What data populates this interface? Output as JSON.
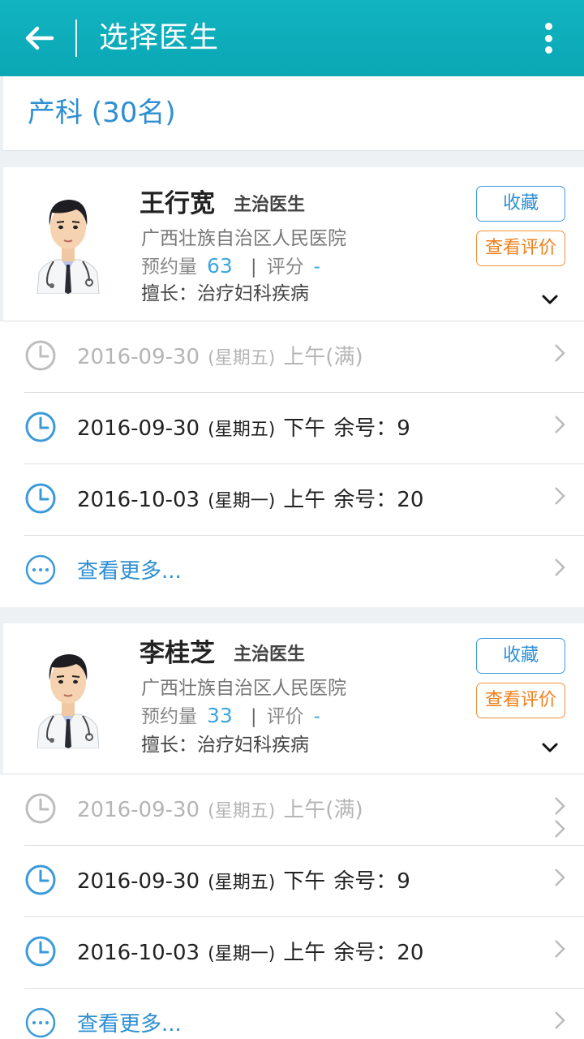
{
  "header": {
    "title": "选择医生"
  },
  "department": {
    "title": "产科  (30名)"
  },
  "doctors": [
    {
      "name": "王行宽",
      "title": "主治医生",
      "hospital": "广西壮族自治区人民医院",
      "stats_label": "预约量",
      "stats_value": "63",
      "rating_label": "评分",
      "rating_value": "-",
      "skill": "擅长：治疗妇科疾病",
      "favorite_label": "收藏",
      "review_label": "查看评价",
      "slots": [
        {
          "date": "2016-09-30",
          "weekday": "(星期五)",
          "period": "上午",
          "status": "(满)",
          "disabled": true
        },
        {
          "date": "2016-09-30",
          "weekday": "(星期五)",
          "period": "下午",
          "status": "余号：9",
          "disabled": false
        },
        {
          "date": "2016-10-03",
          "weekday": "(星期一)",
          "period": "上午",
          "status": "余号：20",
          "disabled": false
        }
      ],
      "more_label": "查看更多..."
    },
    {
      "name": "李桂芝",
      "title": "主治医生",
      "hospital": "广西壮族自治区人民医院",
      "stats_label": "预约量",
      "stats_value": "33",
      "rating_label": "评价",
      "rating_value": "-",
      "skill": "擅长：治疗妇科疾病",
      "favorite_label": "收藏",
      "review_label": "查看评价",
      "slots": [
        {
          "date": "2016-09-30",
          "weekday": "(星期五)",
          "period": "上午",
          "status": "(满)",
          "disabled": true
        },
        {
          "date": "2016-09-30",
          "weekday": "(星期五)",
          "period": "下午",
          "status": "余号：9",
          "disabled": false
        },
        {
          "date": "2016-10-03",
          "weekday": "(星期一)",
          "period": "上午",
          "status": "余号：20",
          "disabled": false
        }
      ],
      "more_label": "查看更多..."
    }
  ],
  "colors": {
    "header": "#0aa7b4",
    "accent_blue": "#2e8fd2",
    "accent_orange": "#ef7f1a",
    "disabled_text": "#b5b5b5"
  },
  "icons": [
    "back-arrow-icon",
    "more-vertical-icon",
    "clock-icon",
    "chevron-right-icon",
    "chevron-down-icon",
    "more-dots-icon",
    "doctor-avatar-icon"
  ]
}
